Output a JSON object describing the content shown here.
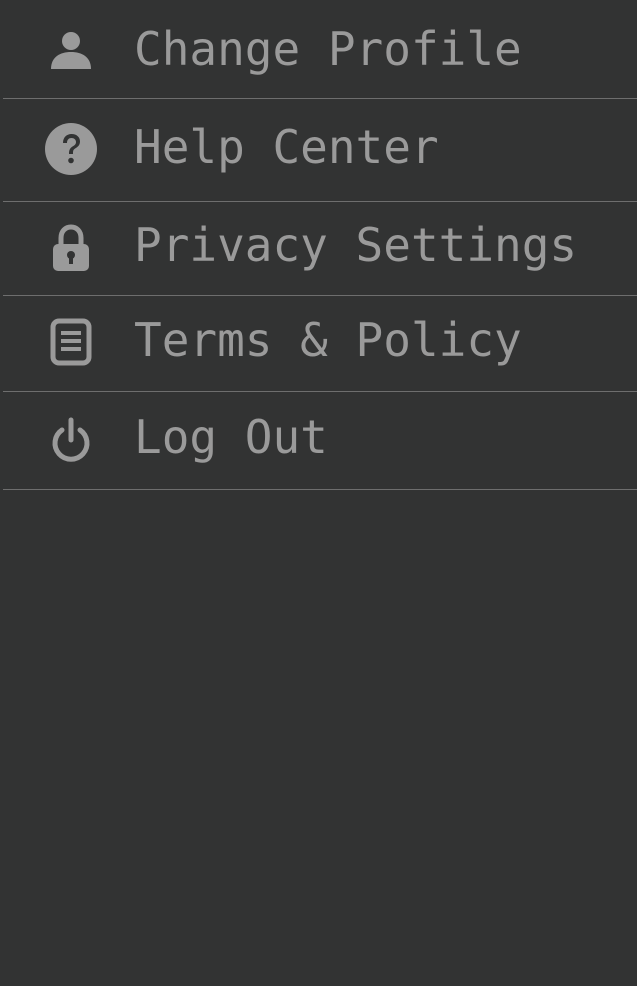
{
  "theme": {
    "background": "#323333",
    "text": "#9a9a9a",
    "icon": "#9a9a9a",
    "divider": "#6e6e6e"
  },
  "menu": {
    "items": [
      {
        "label": "Change Profile",
        "icon": "user-icon"
      },
      {
        "label": "Help Center",
        "icon": "question-circle-icon"
      },
      {
        "label": "Privacy Settings",
        "icon": "lock-icon"
      },
      {
        "label": "Terms & Policy",
        "icon": "document-icon"
      },
      {
        "label": "Log Out",
        "icon": "power-icon"
      }
    ]
  }
}
